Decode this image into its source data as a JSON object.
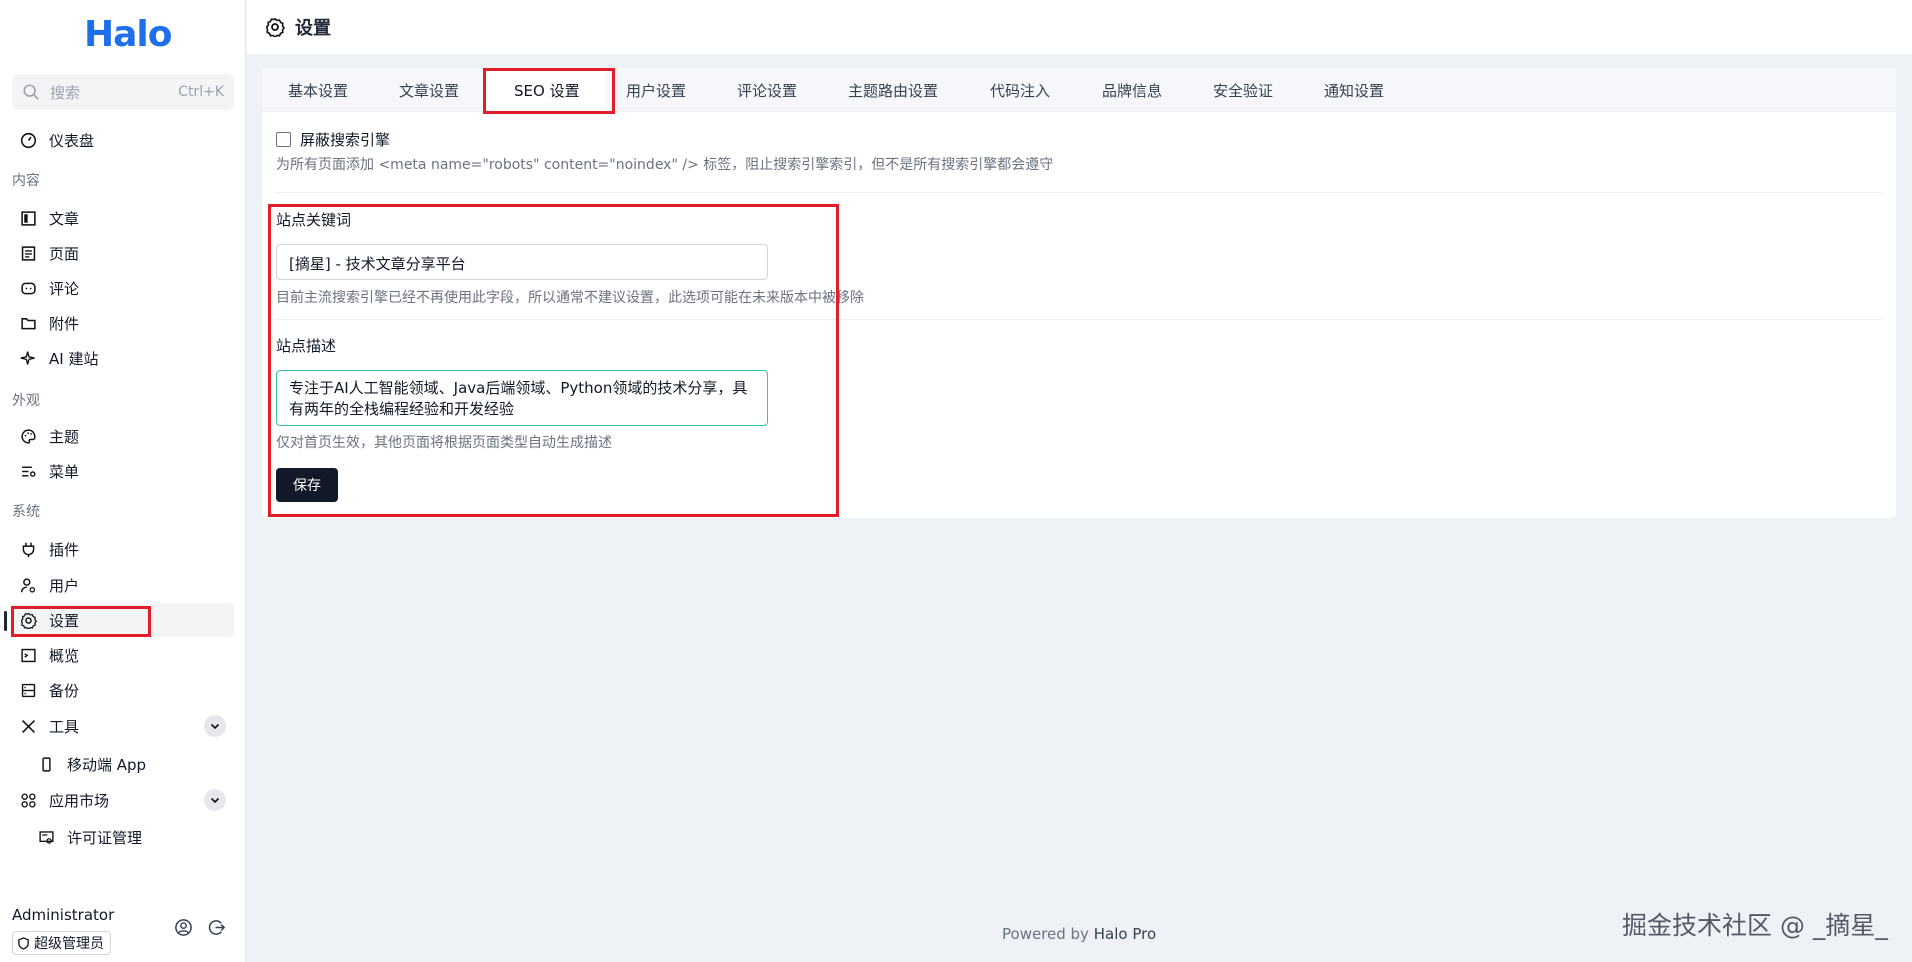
{
  "app": {
    "logo": "Halo",
    "page_title": "设置"
  },
  "search": {
    "placeholder": "搜索",
    "shortcut": "Ctrl+K"
  },
  "sidebar": {
    "dashboard": "仪表盘",
    "groups": {
      "content": "内容",
      "appearance": "外观",
      "system": "系统"
    },
    "items": {
      "posts": "文章",
      "pages": "页面",
      "comments": "评论",
      "attachments": "附件",
      "ai_site": "AI 建站",
      "themes": "主题",
      "menus": "菜单",
      "plugins": "插件",
      "users": "用户",
      "settings": "设置",
      "overview": "概览",
      "backup": "备份",
      "tools": "工具",
      "mobile_app": "移动端 App",
      "app_market": "应用市场",
      "license": "许可证管理"
    }
  },
  "user": {
    "name": "Administrator",
    "role": "超级管理员"
  },
  "tabs": [
    "基本设置",
    "文章设置",
    "SEO 设置",
    "用户设置",
    "评论设置",
    "主题路由设置",
    "代码注入",
    "品牌信息",
    "安全验证",
    "通知设置"
  ],
  "active_tab": "SEO 设置",
  "seo": {
    "block_engines_label": "屏蔽搜索引擎",
    "block_engines_checked": false,
    "block_engines_help": "为所有页面添加 <meta name=\"robots\" content=\"noindex\" /> 标签，阻止搜索引擎索引，但不是所有搜索引擎都会遵守",
    "keywords_label": "站点关键词",
    "keywords_value": "[摘星] - 技术文章分享平台",
    "keywords_help": "目前主流搜索引擎已经不再使用此字段，所以通常不建议设置，此选项可能在未来版本中被移除",
    "description_label": "站点描述",
    "description_value": "专注于AI人工智能领域、Java后端领域、Python领域的技术分享，具有两年的全栈编程经验和开发经验",
    "description_help": "仅对首页生效，其他页面将根据页面类型自动生成描述",
    "save_label": "保存"
  },
  "footer": {
    "prefix": "Powered by",
    "brand": "Halo Pro"
  },
  "watermark": "掘金技术社区 @ _摘星_",
  "colors": {
    "brand": "#1f6feb",
    "highlight": "#e11d2a",
    "primary_button": "#111827"
  }
}
